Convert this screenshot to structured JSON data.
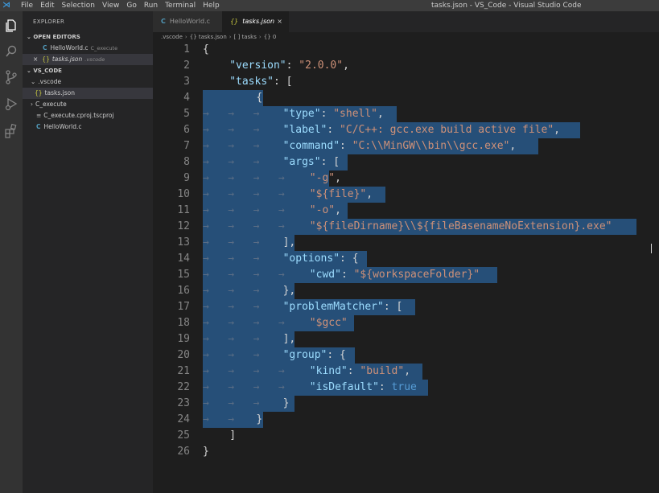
{
  "window": {
    "title": "tasks.json - VS_Code - Visual Studio Code",
    "menu": [
      "File",
      "Edit",
      "Selection",
      "View",
      "Go",
      "Run",
      "Terminal",
      "Help"
    ]
  },
  "sidebar": {
    "header": "EXPLORER",
    "open_editors_label": "OPEN EDITORS",
    "open_editors": [
      {
        "icon": "C",
        "name": "HelloWorld.c",
        "detail": "C_execute"
      },
      {
        "close": "×",
        "icon": "{}",
        "name": "tasks.json",
        "detail": ".vscode"
      }
    ],
    "workspace_label": "VS_CODE",
    "tree": [
      {
        "name": ".vscode",
        "type": "folder"
      },
      {
        "icon": "{}",
        "name": "tasks.json",
        "type": "file"
      },
      {
        "name": "C_execute",
        "type": "folder"
      },
      {
        "icon": "≡",
        "name": "C_execute.cproj.tscproj",
        "type": "file"
      },
      {
        "icon": "C",
        "name": "HelloWorld.c",
        "type": "file"
      }
    ]
  },
  "tabs": [
    {
      "icon": "C",
      "label": "HelloWorld.c"
    },
    {
      "icon": "{}",
      "label": "tasks.json",
      "close": "×"
    }
  ],
  "breadcrumb": [
    ".vscode",
    "{} tasks.json",
    "[ ] tasks",
    "{} 0"
  ],
  "editor": {
    "line_numbers": [
      "1",
      "2",
      "3",
      "4",
      "5",
      "6",
      "7",
      "8",
      "9",
      "10",
      "11",
      "12",
      "13",
      "14",
      "15",
      "16",
      "17",
      "18",
      "19",
      "20",
      "21",
      "22",
      "23",
      "24",
      "25",
      "26"
    ]
  },
  "colors": {
    "selection": "#264f78",
    "key": "#9cdcfe",
    "string": "#ce9178",
    "boolean": "#569cd6"
  }
}
